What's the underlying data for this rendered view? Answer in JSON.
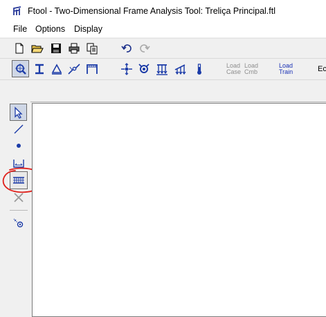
{
  "window": {
    "title": "Ftool - Two-Dimensional Frame Analysis Tool: Treliça Principal.ftl"
  },
  "menu": {
    "items": [
      "File",
      "Options",
      "Display"
    ]
  },
  "toolbar_main": {
    "icons": [
      "new-file-icon",
      "open-folder-icon",
      "save-icon",
      "print-icon",
      "copy-icon",
      "undo-icon",
      "redo-icon"
    ]
  },
  "toolbar_attributes": {
    "icons": [
      "zoom-select-icon",
      "section-icon",
      "material-icon",
      "hinge-icon",
      "frame-icon",
      "support-icon",
      "spring-icon",
      "distributed-load-icon",
      "linear-load-icon",
      "temperature-icon"
    ],
    "load_case_label": "Load\nCase",
    "load_comb_label": "Load\nCmb",
    "load_train_label": "Load\nTrain",
    "trailing_text": "Ec"
  },
  "tools": {
    "icons": [
      "select-arrow-icon",
      "line-icon",
      "node-dot-icon",
      "dimension-icon",
      "truss-grid-icon",
      "delete-x-icon",
      "attributes-icon"
    ]
  },
  "annotation": {
    "color": "#e0201b"
  },
  "colors": {
    "icon_blue": "#1c3ca8",
    "canvas": "#ffffff"
  }
}
